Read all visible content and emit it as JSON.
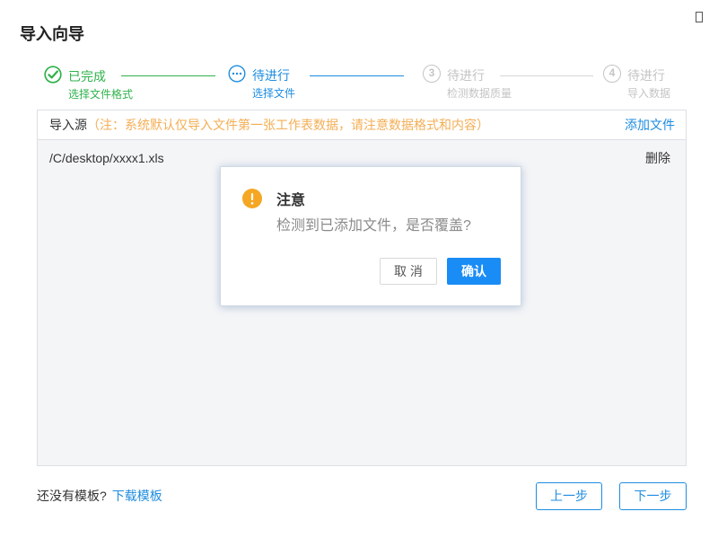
{
  "dialog": {
    "title": "导入向导",
    "close_icon": "close-icon"
  },
  "steps": [
    {
      "icon": "check-circle-icon",
      "status": "已完成",
      "label": "选择文件格式"
    },
    {
      "icon": "ellipsis-circle-icon",
      "status": "待进行",
      "label": "选择文件"
    },
    {
      "number": "3",
      "status": "待进行",
      "label": "检测数据质量"
    },
    {
      "number": "4",
      "status": "待进行",
      "label": "导入数据"
    }
  ],
  "source": {
    "header_label": "导入源",
    "note": "（注：系统默认仅导入文件第一张工作表数据，请注意数据格式和内容）",
    "add_file_link": "添加文件",
    "files": [
      {
        "path": "/C/desktop/xxxx1.xls",
        "delete_label": "删除"
      }
    ]
  },
  "confirm_modal": {
    "icon": "warning-icon",
    "title": "注意",
    "message": "检测到已添加文件，是否覆盖?",
    "cancel_label": "取 消",
    "confirm_label": "确认"
  },
  "footer": {
    "no_template_text": "还没有模板?",
    "download_template_link": "下载模板",
    "prev_label": "上一步",
    "next_label": "下一步"
  },
  "theme": {
    "success": "#2fb24c",
    "primary": "#1e8de0",
    "muted": "#c4c4c4",
    "muted_line": "#d6d6d6",
    "warning": "#f5a623",
    "note": "#f4ae55"
  }
}
